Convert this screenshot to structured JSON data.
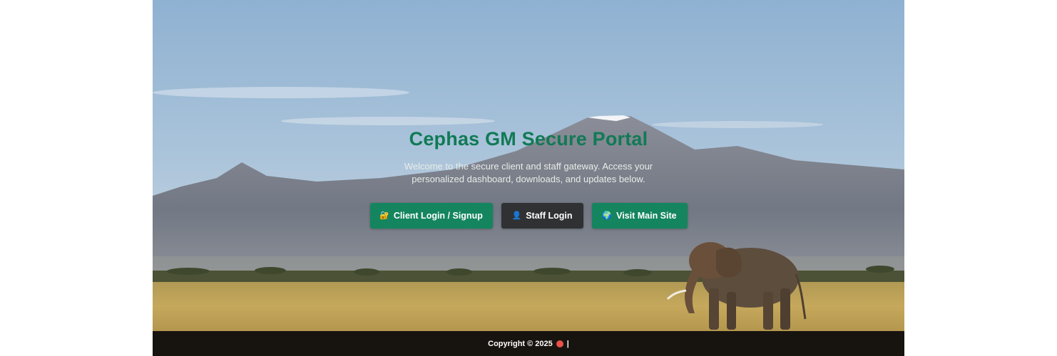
{
  "hero": {
    "title": "Cephas GM Secure Portal",
    "subtitle": "Welcome to the secure client and staff gateway. Access your personalized dashboard, downloads, and updates below.",
    "background": "mountain-savanna-elephant-photo",
    "title_color": "#117a55"
  },
  "actions": {
    "client": {
      "icon": "lock-icon",
      "label": "Client Login / Signup"
    },
    "staff": {
      "icon": "person-icon",
      "label": "Staff Login"
    },
    "main_site": {
      "icon": "globe-icon",
      "label": "Visit Main Site"
    }
  },
  "footer": {
    "copyright": "Copyright © 2025",
    "separator": "|"
  },
  "colors": {
    "primary_button": "#14855e",
    "dark_button": "#303133",
    "footer_bg": "#17130f"
  }
}
